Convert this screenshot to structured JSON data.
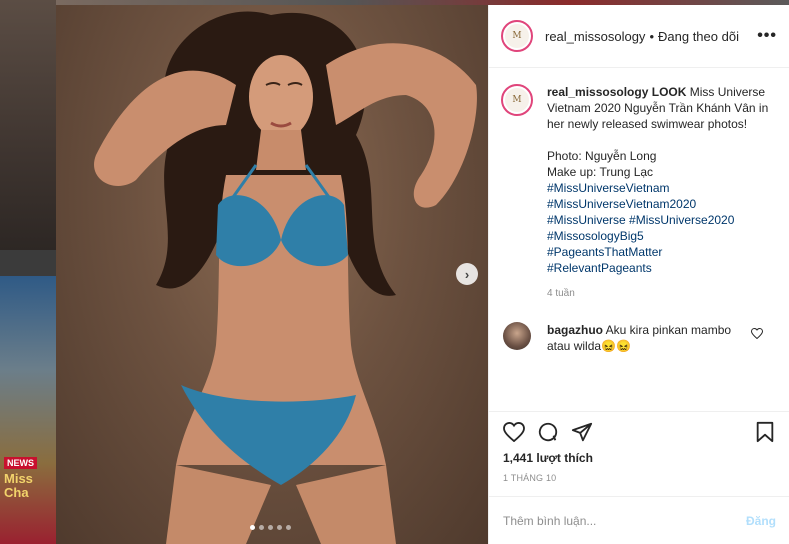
{
  "header": {
    "username": "real_missosology",
    "separator": "•",
    "follow_status": "Đang theo dõi",
    "more": "•••"
  },
  "caption": {
    "username": "real_missosology",
    "text": "LOOK Miss Universe Vietnam 2020 Nguyễn Trần Khánh Vân in her newly released swimwear photos!\n\nPhoto: Nguyễn Long\nMake up: Trung Lạc\n",
    "hashtags": [
      "#MissUniverseVietnam",
      "#MissUniverseVietnam2020",
      "#MissUniverse #MissUniverse2020",
      "#MissosologyBig5",
      "#PageantsThatMatter",
      "#RelevantPageants"
    ],
    "time": "4 tuần"
  },
  "comment": {
    "username": "bagazhuo",
    "text": "Aku kira pinkan mambo atau wilda😖😖"
  },
  "engagement": {
    "likes": "1,441 lượt thích",
    "date": "1 THÁNG 10"
  },
  "add_comment": {
    "placeholder": "Thêm bình luận...",
    "post_label": "Đăng"
  },
  "backdrop": {
    "badge": "NEWS",
    "headline": "Miss\nCha"
  },
  "carousel": {
    "next": "›",
    "slide_count": 5,
    "active_index": 0
  },
  "avatar_mark": "M"
}
